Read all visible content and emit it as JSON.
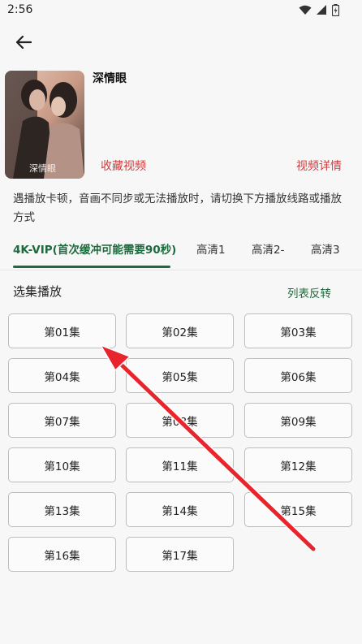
{
  "status": {
    "time": "2:56"
  },
  "show": {
    "title": "深情眼"
  },
  "actions": {
    "favorite": "收藏视频",
    "details": "视频详情"
  },
  "notice": "遇播放卡顿，音画不同步或无法播放时，请切换下方播放线路或播放方式",
  "tabs": [
    {
      "label": "4K-VIP(首次缓冲可能需要90秒)",
      "active": true
    },
    {
      "label": "高清1",
      "active": false
    },
    {
      "label": "高清2-",
      "active": false
    },
    {
      "label": "高清3",
      "active": false
    }
  ],
  "episodes_section": {
    "title": "选集播放",
    "reverse_label": "列表反转"
  },
  "episodes": [
    "第01集",
    "第02集",
    "第03集",
    "第04集",
    "第05集",
    "第06集",
    "第07集",
    "第08集",
    "第09集",
    "第10集",
    "第11集",
    "第12集",
    "第13集",
    "第14集",
    "第15集",
    "第16集",
    "第17集"
  ],
  "colors": {
    "accent_green": "#1d6a3d",
    "link_red": "#d23a3a",
    "annotation_arrow": "#e8242c"
  }
}
